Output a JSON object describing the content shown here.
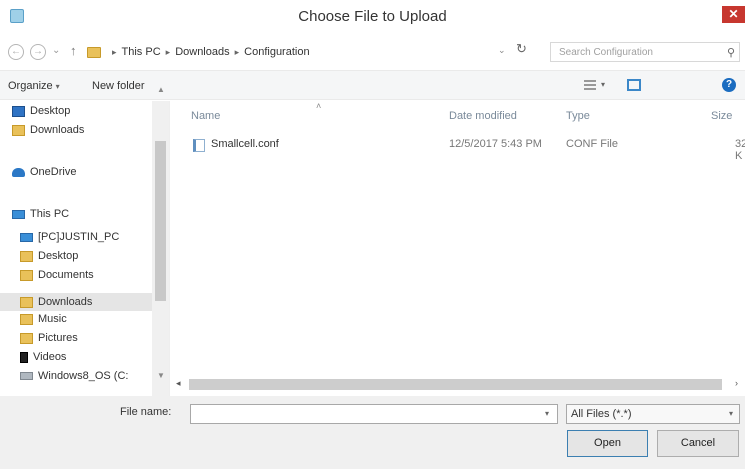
{
  "window": {
    "title": "Choose File to Upload",
    "close_glyph": "✕"
  },
  "nav": {
    "back_glyph": "←",
    "forward_glyph": "→",
    "recent_glyph": "⌄",
    "up_glyph": "↑",
    "breadcrumb": [
      "This PC",
      "Downloads",
      "Configuration"
    ],
    "sep_glyph": "▸",
    "dropdown_glyph": "⌄",
    "refresh_glyph": "↻",
    "search_placeholder": "Search Configuration",
    "search_glyph": "⚲"
  },
  "toolbar": {
    "organize_label": "Organize",
    "new_folder_label": "New folder",
    "caret": "▾",
    "help_glyph": "?"
  },
  "sidebar": {
    "items": [
      {
        "label": "Desktop",
        "icon": "desktop-icon"
      },
      {
        "label": "Downloads",
        "icon": "downloads-folder-icon"
      },
      {
        "label": "OneDrive",
        "icon": "onedrive-icon"
      },
      {
        "label": "This PC",
        "icon": "this-pc-icon"
      },
      {
        "label": "[PC]JUSTIN_PC",
        "icon": "network-pc-icon"
      },
      {
        "label": "Desktop",
        "icon": "desktop-folder-icon"
      },
      {
        "label": "Documents",
        "icon": "documents-icon"
      },
      {
        "label": "Downloads",
        "icon": "downloads-folder-icon",
        "selected": true
      },
      {
        "label": "Music",
        "icon": "music-icon"
      },
      {
        "label": "Pictures",
        "icon": "pictures-icon"
      },
      {
        "label": "Videos",
        "icon": "videos-icon"
      },
      {
        "label": "Windows8_OS (C:",
        "icon": "drive-icon"
      }
    ],
    "scroll_up_glyph": "▲",
    "scroll_down_glyph": "▼"
  },
  "file_list": {
    "columns": {
      "name": "Name",
      "date": "Date modified",
      "type": "Type",
      "size": "Size"
    },
    "sort_glyph": "˄",
    "rows": [
      {
        "name": "Smallcell.conf",
        "date": "12/5/2017 5:43 PM",
        "type": "CONF File",
        "size": "32 K"
      }
    ],
    "scroll_left_glyph": "◂",
    "scroll_right_glyph": "›"
  },
  "footer": {
    "file_name_label": "File name:",
    "file_name_value": "",
    "name_dropdown_glyph": "▾",
    "filter_value": "All Files (*.*)",
    "filter_caret": "▾",
    "open_label": "Open",
    "cancel_label": "Cancel"
  }
}
